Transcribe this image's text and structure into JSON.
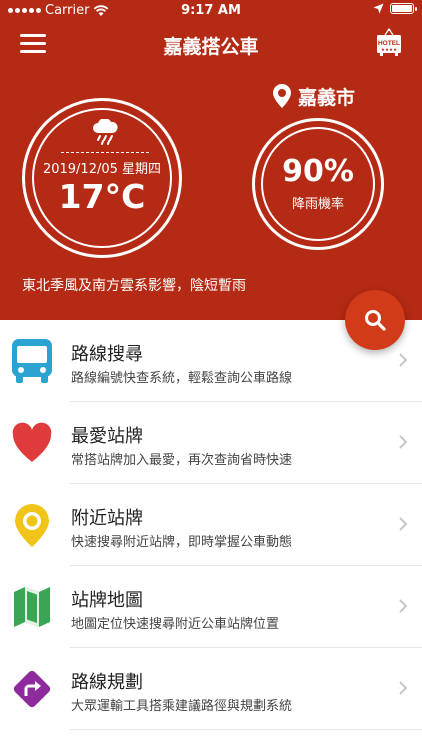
{
  "status_bar": {
    "carrier": "Carrier",
    "time": "9:17 AM"
  },
  "nav": {
    "title": "嘉義搭公車",
    "hotel_badge": "HOTEL"
  },
  "weather": {
    "date": "2019/12/05 星期四",
    "temperature": "17°C",
    "location": "嘉義市",
    "rain_probability": "90%",
    "rain_label": "降雨機率",
    "forecast": "東北季風及南方雲系影響，陰短暫雨"
  },
  "menu": [
    {
      "title": "路線搜尋",
      "description": "路線編號快查系統，輕鬆查詢公車路線",
      "icon": "bus-icon",
      "color": "#2aa3d1"
    },
    {
      "title": "最愛站牌",
      "description": "常搭站牌加入最愛，再次查詢省時快速",
      "icon": "heart-icon",
      "color": "#e03b3b"
    },
    {
      "title": "附近站牌",
      "description": "快速搜尋附近站牌，即時掌握公車動態",
      "icon": "location-pin-icon",
      "color": "#f0c419"
    },
    {
      "title": "站牌地圖",
      "description": "地圖定位快速搜尋附近公車站牌位置",
      "icon": "map-icon",
      "color": "#3aa655"
    },
    {
      "title": "路線規劃",
      "description": "大眾運輸工具搭乘建議路徑與規劃系統",
      "icon": "route-sign-icon",
      "color": "#8e2a9e"
    }
  ],
  "colors": {
    "header_bg": "#b52a14",
    "fab_bg": "#d23b1a"
  }
}
